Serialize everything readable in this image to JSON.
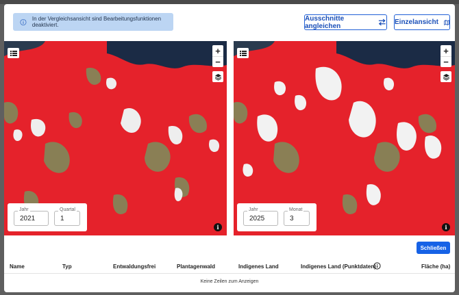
{
  "banner": {
    "text": "In der Vergleichsansicht sind Bearbeitungsfunktionen deaktiviert.",
    "icon": "info-icon"
  },
  "toolbar": {
    "align_label": "Ausschnitte angleichen",
    "align_icon": "swap-arrows-icon",
    "single_label": "Einzelansicht",
    "single_icon": "map-icon",
    "accent": "#1f5fd6"
  },
  "map_controls": {
    "zoom_in": "+",
    "zoom_out": "−",
    "info": "i"
  },
  "left_map": {
    "period_label_1": "Jahr",
    "period_value_1": "2021",
    "period_label_2": "Quartal",
    "period_value_2": "1"
  },
  "right_map": {
    "period_label_1": "Jahr",
    "period_value_1": "2025",
    "period_label_2": "Monat",
    "period_value_2": "3"
  },
  "close_button": "Schließen",
  "table": {
    "columns": [
      "Name",
      "Typ",
      "Entwaldungsfrei",
      "Plantagenwald",
      "Indigenes Land",
      "Indigenes Land (Punktdaten)",
      "Fläche (ha)"
    ],
    "empty_message": "Keine Zeilen zum Anzeigen"
  },
  "colors": {
    "forest_red": "#e8202a",
    "water": "#1b2b45",
    "primary_button": "#1662e6",
    "banner_bg": "#bcd5f3"
  }
}
